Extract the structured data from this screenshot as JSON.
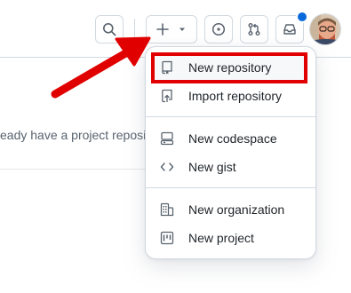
{
  "header": {
    "search_icon": "search-icon",
    "create_icon": "plus-icon",
    "create_dropdown_icon": "triangle-down-icon",
    "issues_icon": "issue-opened-icon",
    "pulls_icon": "git-pull-request-icon",
    "inbox_icon": "inbox-icon",
    "notification_color": "#0969da"
  },
  "background": {
    "text": "eady have a project reposit"
  },
  "menu": {
    "items": [
      {
        "label": "New repository",
        "icon": "repo-icon"
      },
      {
        "label": "Import repository",
        "icon": "repo-push-icon"
      },
      {
        "label": "New codespace",
        "icon": "codespaces-icon"
      },
      {
        "label": "New gist",
        "icon": "code-icon"
      },
      {
        "label": "New organization",
        "icon": "organization-icon"
      },
      {
        "label": "New project",
        "icon": "project-icon"
      }
    ]
  },
  "annotation": {
    "color": "#e00000",
    "highlighted_item": "New repository"
  }
}
